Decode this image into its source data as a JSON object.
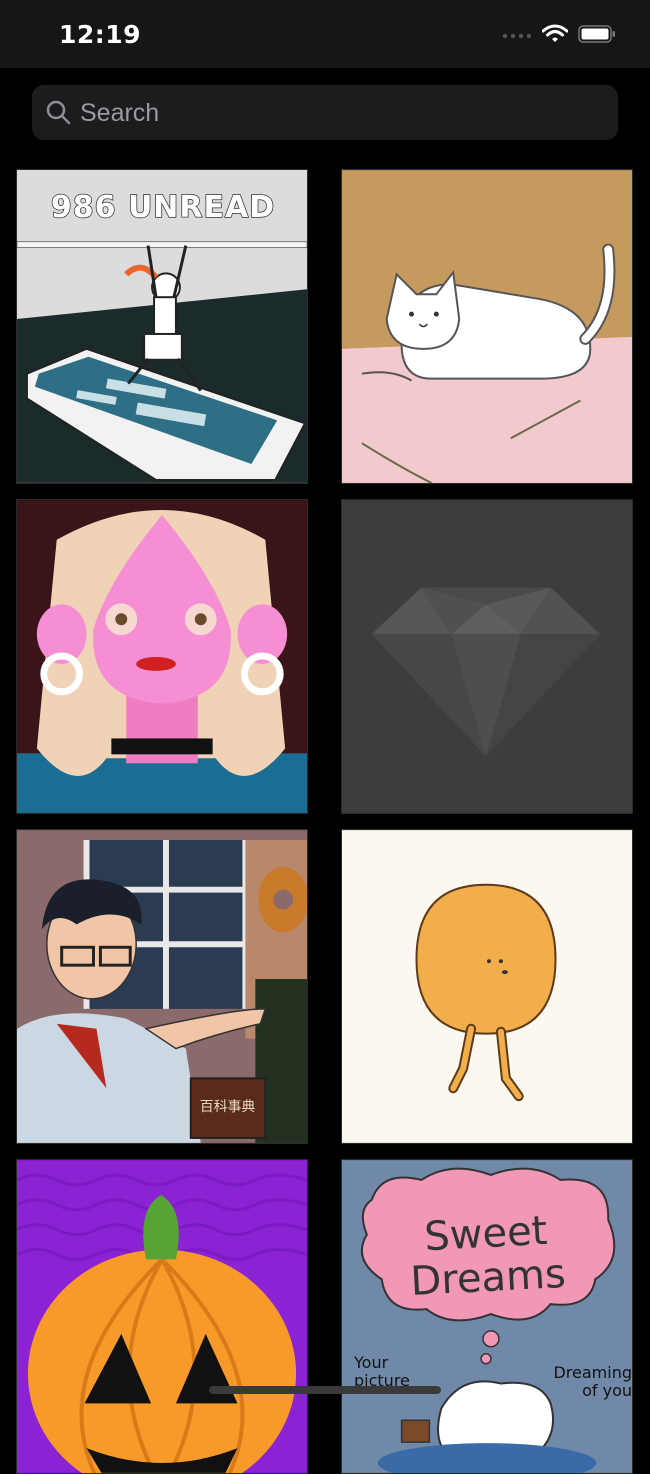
{
  "status_bar": {
    "time": "12:19",
    "icons": [
      "signal-dots-icon",
      "wifi-icon",
      "battery-icon"
    ]
  },
  "search": {
    "placeholder": "Search",
    "value": ""
  },
  "grid": {
    "items": [
      {
        "name": "gif-986-unread",
        "text": "986 UNREAD"
      },
      {
        "name": "gif-cat-stretching"
      },
      {
        "name": "gif-pink-face-crying"
      },
      {
        "name": "gif-diamond-placeholder"
      },
      {
        "name": "gif-is-this-a-pigeon"
      },
      {
        "name": "gif-walking-potato"
      },
      {
        "name": "gif-crochet-pumpkin"
      },
      {
        "name": "gif-sweet-dreams",
        "text": "Sweet Dreams",
        "label_left": "Your picture",
        "label_right": "Dreaming of you"
      }
    ]
  },
  "colors": {
    "background": "#000000",
    "status_bar": "#161616",
    "search_field": "#1c1c1e",
    "placeholder": "#9a9a9f"
  }
}
